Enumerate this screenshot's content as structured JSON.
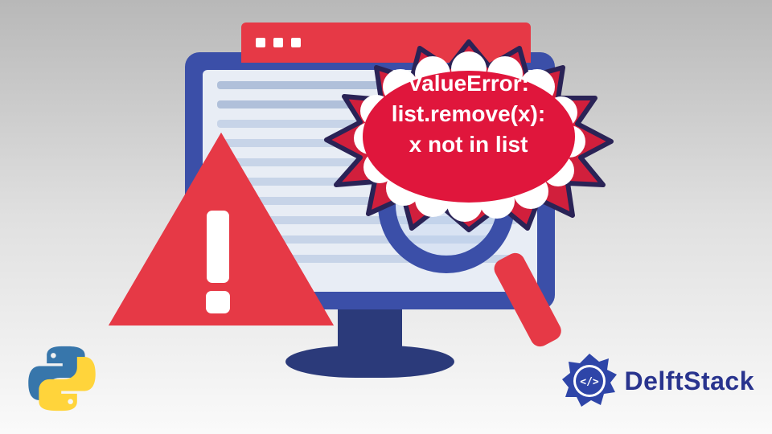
{
  "error": {
    "line1": "ValueError:",
    "line2": "list.remove(x):",
    "line3": "x not in list"
  },
  "branding": {
    "site_name": "DelftStack"
  },
  "icons": {
    "warning": "warning-triangle",
    "magnifier": "magnifier",
    "python": "python-logo",
    "delftstack": "delftstack-logo"
  },
  "colors": {
    "accent_red": "#e63946",
    "monitor_blue": "#3b4fa8",
    "brand_blue": "#29348e",
    "python_blue": "#3776ab",
    "python_yellow": "#ffd43b"
  }
}
